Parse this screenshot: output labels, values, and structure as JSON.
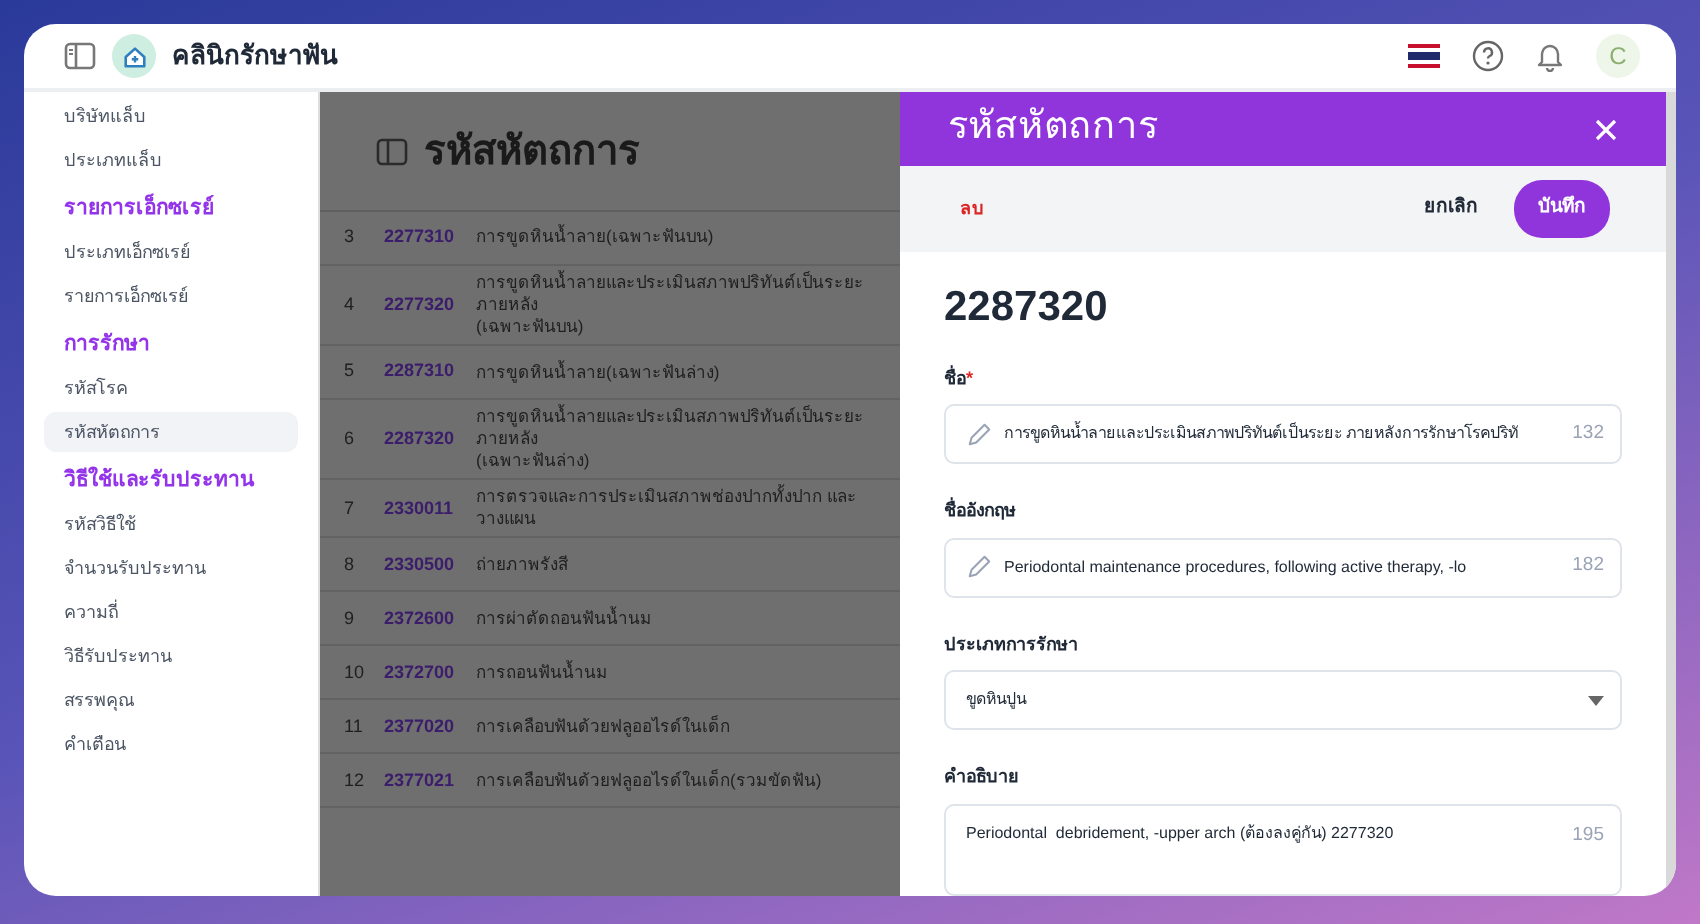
{
  "app": {
    "name": "คลินิกรักษาฟัน"
  },
  "header": {
    "avatar": "C"
  },
  "sidebar": {
    "sections": [
      {
        "items": [
          {
            "label": "บริษัทแล็บ",
            "selected": false
          },
          {
            "label": "ประเภทแล็บ",
            "selected": false
          }
        ]
      },
      {
        "title": "รายการเอ็กซเรย์",
        "items": [
          {
            "label": "ประเภทเอ็กซเรย์",
            "selected": false
          },
          {
            "label": "รายการเอ็กซเรย์",
            "selected": false
          }
        ]
      },
      {
        "title": "การรักษา",
        "items": [
          {
            "label": "รหัสโรค",
            "selected": false
          },
          {
            "label": "รหัสหัตถการ",
            "selected": true
          }
        ]
      },
      {
        "title": "วิธีใช้และรับประทาน",
        "items": [
          {
            "label": "รหัสวิธีใช้",
            "selected": false
          },
          {
            "label": "จำนวนรับประทาน",
            "selected": false
          },
          {
            "label": "ความถี่",
            "selected": false
          },
          {
            "label": "วิธีรับประทาน",
            "selected": false
          },
          {
            "label": "สรรพคุณ",
            "selected": false
          },
          {
            "label": "คำเตือน",
            "selected": false
          }
        ]
      }
    ]
  },
  "page": {
    "title": "รหัสหัตถการ"
  },
  "table": {
    "rows": [
      {
        "number": "3",
        "code": "2277310",
        "description": [
          "การขูดหินน้ำลาย(เฉพาะฟันบน)"
        ]
      },
      {
        "number": "4",
        "code": "2277320",
        "description": [
          "การขูดหินน้ำลายและประเมินสภาพปริทันต์เป็นระยะ ภายหลัง",
          "(เฉพาะฟันบน)"
        ]
      },
      {
        "number": "5",
        "code": "2287310",
        "description": [
          "การขูดหินน้ำลาย(เฉพาะฟันล่าง)"
        ]
      },
      {
        "number": "6",
        "code": "2287320",
        "description": [
          "การขูดหินน้ำลายและประเมินสภาพปริทันต์เป็นระยะ ภายหลัง",
          "(เฉพาะฟันล่าง)"
        ]
      },
      {
        "number": "7",
        "code": "2330011",
        "description": [
          "การตรวจและการประเมินสภาพช่องปากทั้งปาก และวางแผน"
        ]
      },
      {
        "number": "8",
        "code": "2330500",
        "description": [
          "ถ่ายภาพรังสี"
        ]
      },
      {
        "number": "9",
        "code": "2372600",
        "description": [
          "การผ่าตัดถอนฟันน้ำนม"
        ]
      },
      {
        "number": "10",
        "code": "2372700",
        "description": [
          "การถอนฟันน้ำนม"
        ]
      },
      {
        "number": "11",
        "code": "2377020",
        "description": [
          "การเคลือบฟันด้วยฟลูออไรด์ในเด็ก"
        ]
      },
      {
        "number": "12",
        "code": "2377021",
        "description": [
          "การเคลือบฟันด้วยฟลูออไรด์ในเด็ก(รวมขัดฟัน)"
        ]
      }
    ]
  },
  "drawer": {
    "title": "รหัสหัตถการ",
    "delete": "ลบ",
    "cancel": "ยกเลิก",
    "save": "บันทึก",
    "code": "2287320",
    "fields": [
      {
        "kind": "text",
        "label": "ชื่อ",
        "required_mark": "*",
        "value": "การขูดหินน้ำลายและประเมินสภาพปริทันต์เป็นระยะ ภายหลังการรักษาโรคปริทั",
        "count": "132"
      },
      {
        "kind": "text",
        "label": "ชื่ออังกฤษ",
        "value": "Periodontal maintenance procedures, following active therapy, -lo",
        "count": "182"
      },
      {
        "kind": "select",
        "label": "ประเภทการรักษา",
        "value": "ขูดหินปูน"
      },
      {
        "kind": "textarea",
        "label": "คำอธิบาย",
        "value": "Periodontal  debridement, -upper arch (ต้องลงคู่กัน) 2277320",
        "count": "195"
      }
    ]
  }
}
